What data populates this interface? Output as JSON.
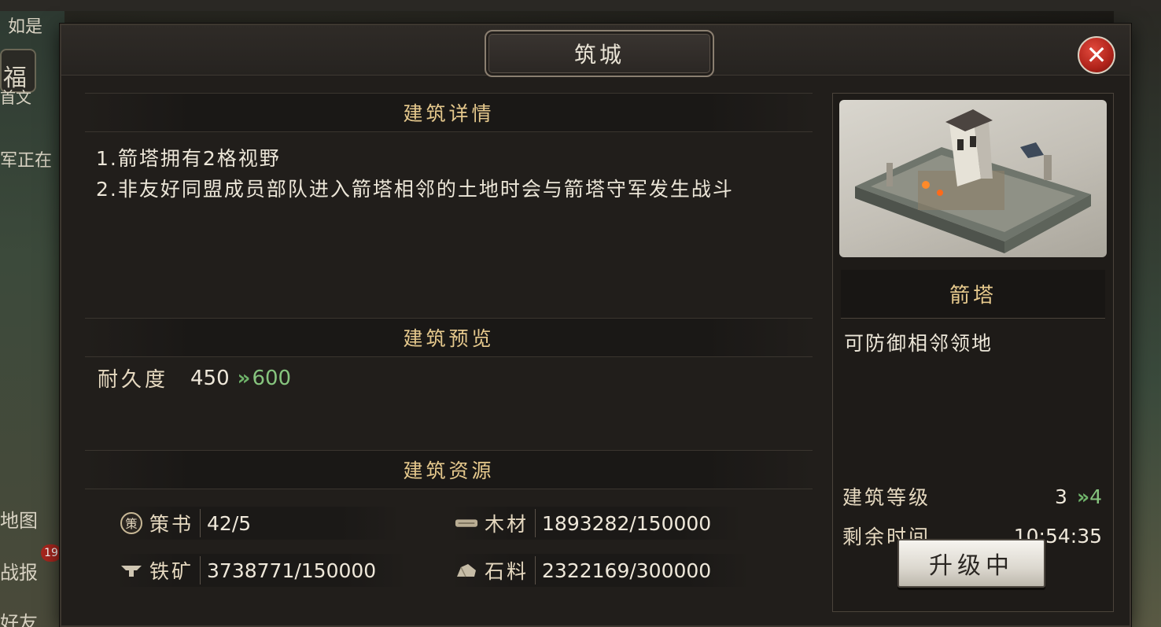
{
  "background": {
    "top_left_text": "如是",
    "left_labels": [
      "福",
      "首文",
      "军正在",
      "地图",
      "战报",
      "好友"
    ],
    "report_badge": "19"
  },
  "dialog": {
    "title": "筑城",
    "close_symbol": "✕"
  },
  "details": {
    "heading": "建筑详情",
    "lines": [
      "1.箭塔拥有2格视野",
      "2.非友好同盟成员部队进入箭塔相邻的土地时会与箭塔守军发生战斗"
    ]
  },
  "preview": {
    "heading": "建筑预览",
    "durability_label": "耐久度",
    "durability_current": "450",
    "durability_next": "600"
  },
  "resources": {
    "heading": "建筑资源",
    "items": [
      {
        "name": "策书",
        "value": "42/5",
        "icon": "policy-book-icon"
      },
      {
        "name": "木材",
        "value": "1893282/150000",
        "icon": "wood-icon"
      },
      {
        "name": "铁矿",
        "value": "3738771/150000",
        "icon": "iron-icon"
      },
      {
        "name": "石料",
        "value": "2322169/300000",
        "icon": "stone-icon"
      }
    ]
  },
  "building": {
    "name": "箭塔",
    "description": "可防御相邻领地",
    "level_label": "建筑等级",
    "level_current": "3",
    "level_next": "4",
    "time_label": "剩余时间",
    "time_remaining": "10:54:35",
    "button_label": "升级中"
  },
  "colors": {
    "accent_gold": "#e6c98d",
    "upgrade_green": "#86c47e",
    "close_red": "#c22a1f"
  }
}
